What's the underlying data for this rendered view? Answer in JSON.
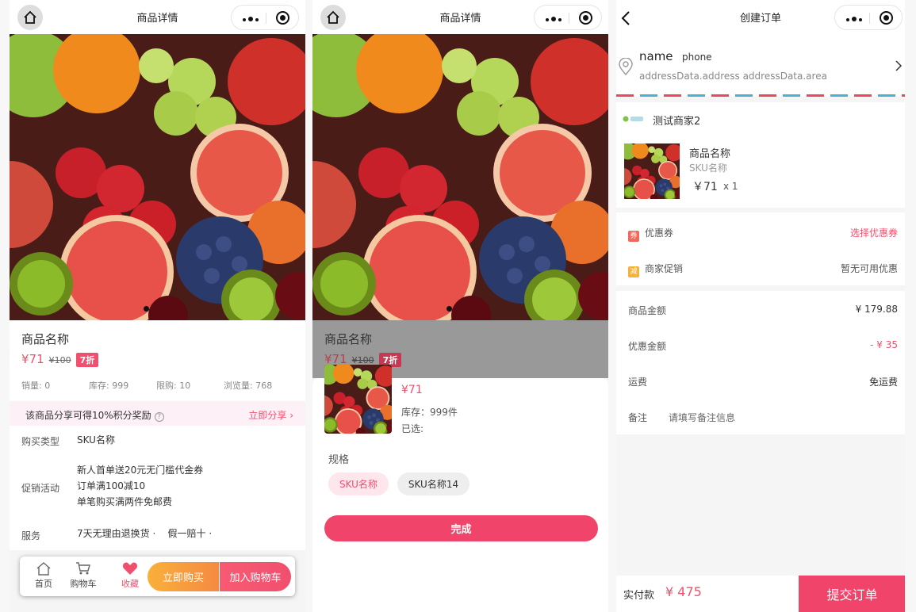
{
  "detail": {
    "nav_title": "商品详情",
    "product_name": "商品名称",
    "price_now": "¥71",
    "price_old": "¥100",
    "discount": "7折",
    "stats": [
      "销量: 0",
      "库存: 999",
      "限购: 10",
      "浏览量: 768"
    ],
    "share_text": "该商品分享可得10%积分奖励",
    "share_link": "立即分享 ›",
    "attrs": {
      "buy_type_label": "购买类型",
      "buy_type_value": "SKU名称",
      "promo_label": "促销活动",
      "promo_lines": [
        "新人首单送20元无门槛代金券",
        "订单满100减10",
        "单笔购买满两件免邮费"
      ],
      "service_label": "服务",
      "service_items": [
        "7天无理由退换货 ·",
        "假一赔十 ·"
      ]
    },
    "bottom": {
      "home": "首页",
      "cart": "购物车",
      "favorite": "收藏",
      "buy_now": "立即购买",
      "add_cart": "加入购物车"
    }
  },
  "sku_sheet": {
    "nav_title": "商品详情",
    "product_name": "商品名称",
    "price_now": "¥71",
    "price_old": "¥100",
    "discount": "7折",
    "price": "¥71",
    "stock": "库存：999件",
    "selected": "已选:",
    "spec_title": "规格",
    "chips": [
      "SKU名称",
      "SKU名称14"
    ],
    "done": "完成"
  },
  "order": {
    "nav_title": "创建订单",
    "name": "name",
    "phone": "phone",
    "address": "addressData.address addressData.area",
    "merchant": "测试商家2",
    "item_name": "商品名称",
    "item_sku": "SKU名称",
    "item_price": "￥71",
    "item_qty": "x 1",
    "coupon_label": "优惠券",
    "coupon_icon": "券",
    "coupon_action": "选择优惠券",
    "promo_label": "商家促销",
    "promo_icon": "减",
    "promo_value": "暂无可用优惠",
    "goods_amount_label": "商品金额",
    "goods_amount": "¥ 179.88",
    "discount_label": "优惠金额",
    "discount_amount": "- ¥ 35",
    "shipping_label": "运费",
    "shipping_value": "免运费",
    "remark_label": "备注",
    "remark_placeholder": "请填写备注信息",
    "total_label": "实付款",
    "total_value": "¥ 475",
    "submit": "提交订单"
  },
  "colors": {
    "accent": "#f0506e",
    "orange": "#f58a42",
    "share_bg": "#fdf0f6"
  }
}
